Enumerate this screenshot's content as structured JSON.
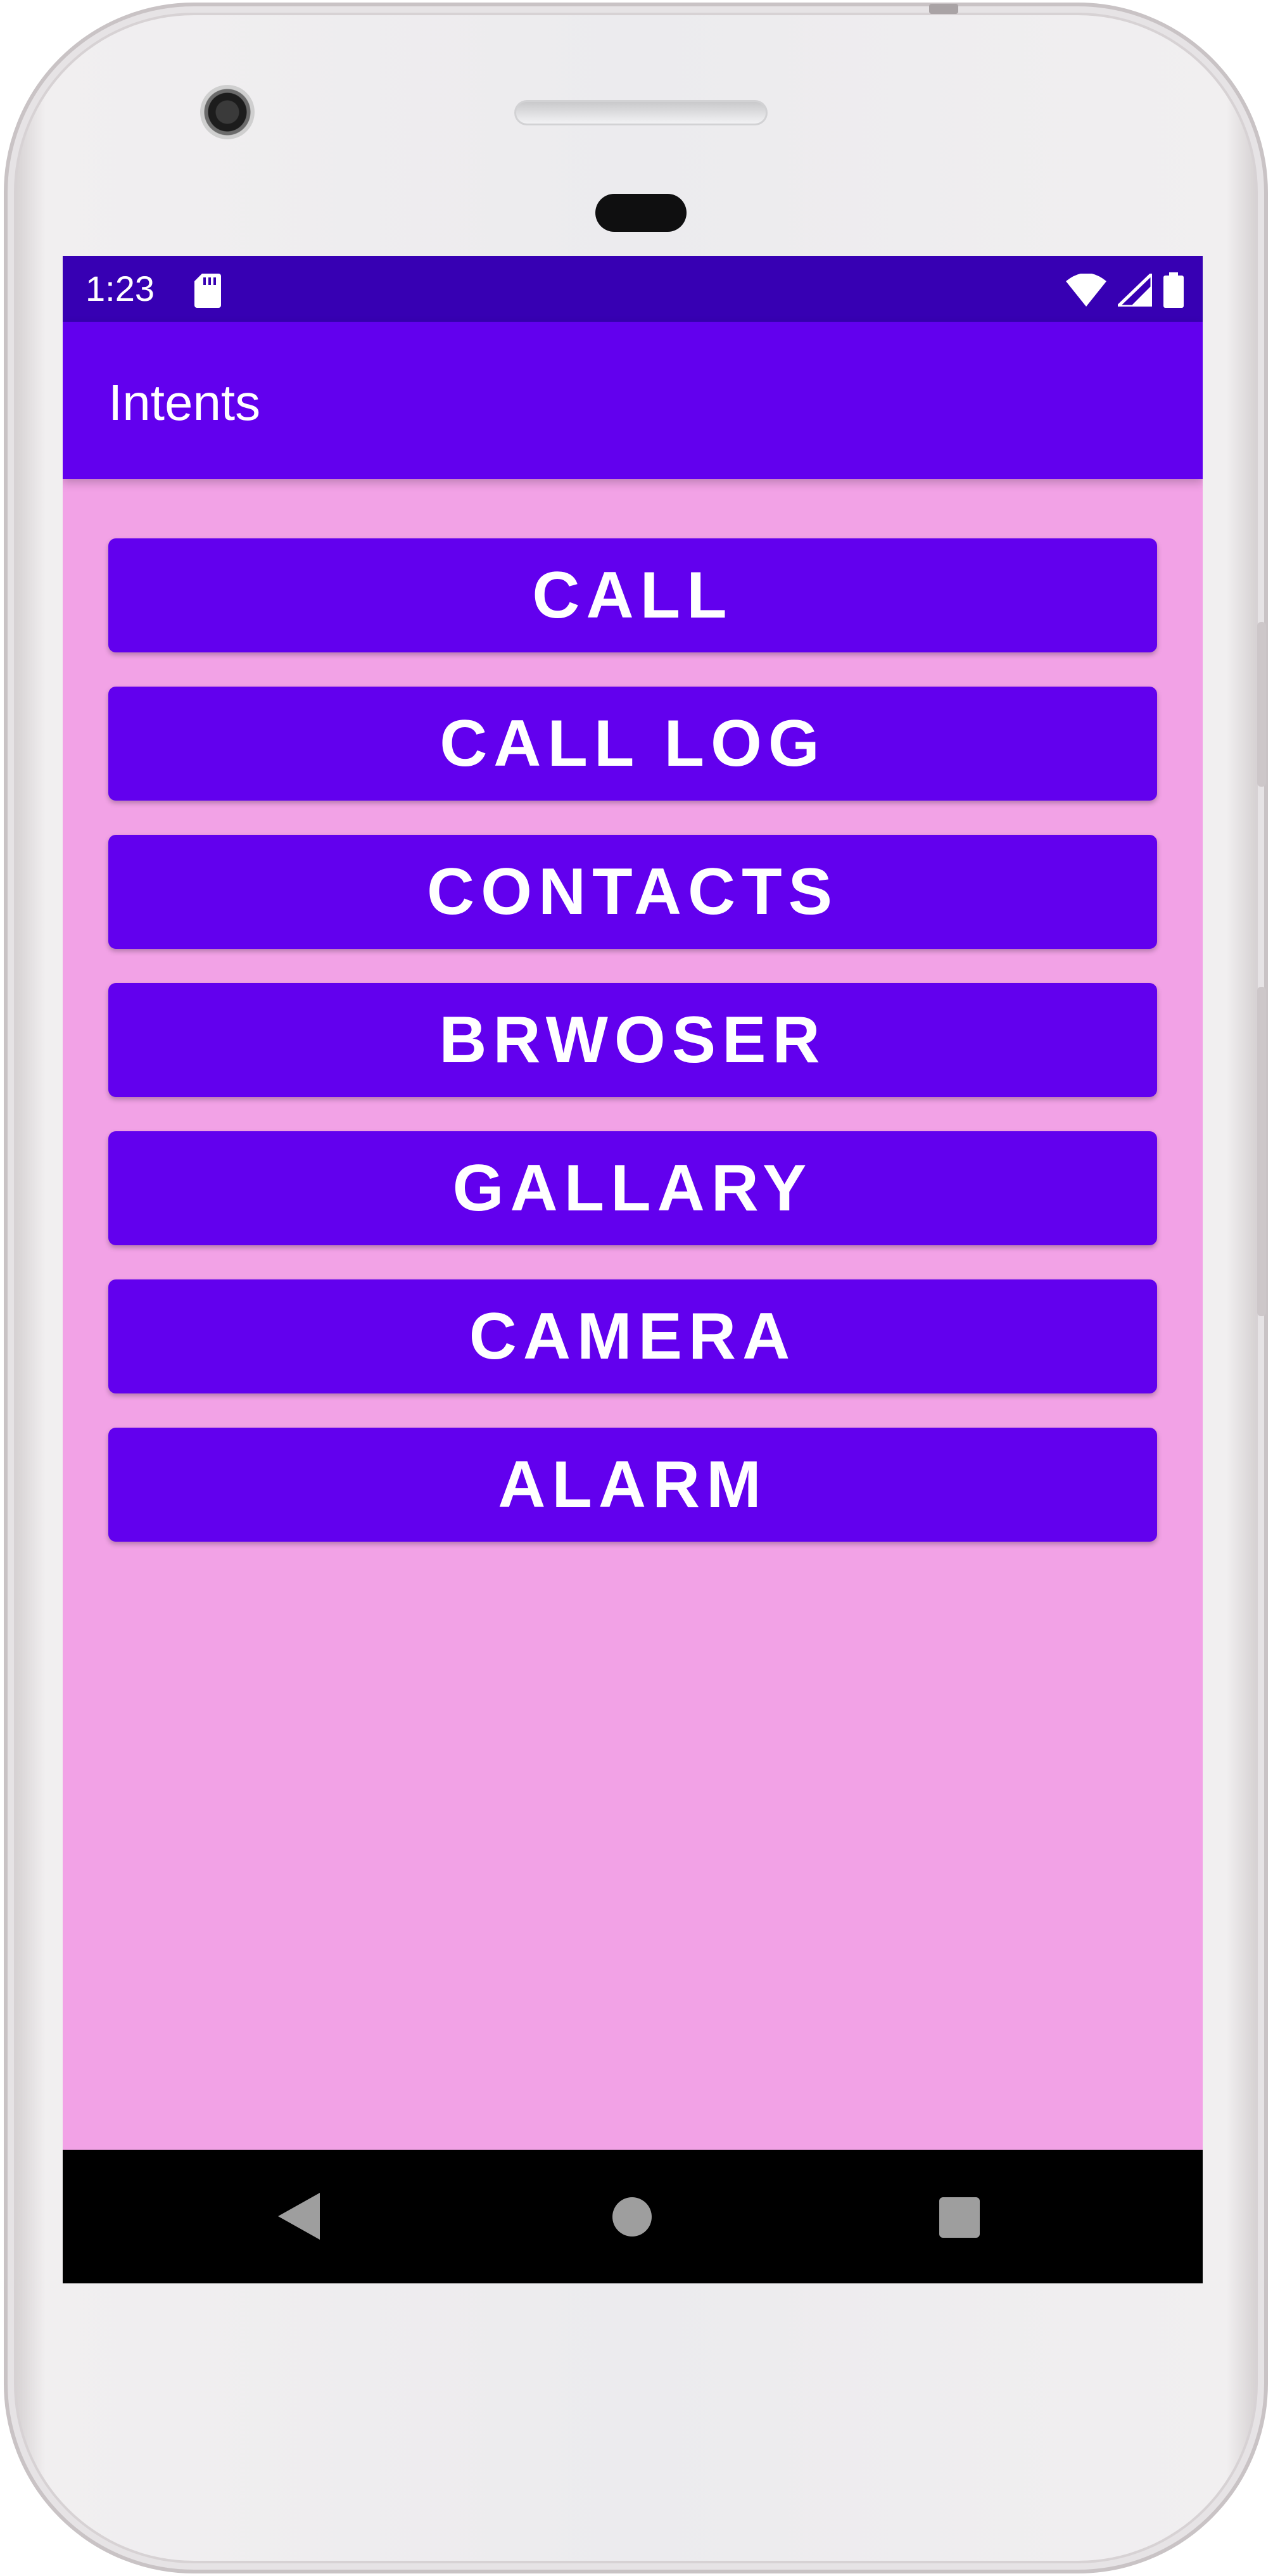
{
  "status_bar": {
    "time": "1:23",
    "icons": [
      "sd-card-icon",
      "wifi-icon",
      "cell-signal-icon",
      "battery-icon"
    ]
  },
  "app_bar": {
    "title": "Intents"
  },
  "buttons": [
    {
      "label": "CALL"
    },
    {
      "label": "CALL LOG"
    },
    {
      "label": "CONTACTS"
    },
    {
      "label": "BRWOSER"
    },
    {
      "label": "GALLARY"
    },
    {
      "label": "CAMERA"
    },
    {
      "label": "ALARM"
    }
  ],
  "nav_bar": {
    "icons": [
      "back-icon",
      "home-icon",
      "recents-icon"
    ]
  },
  "colors": {
    "status_bar": "#3700b3",
    "app_bar": "#6200ee",
    "button": "#6200ee",
    "background": "#f2a2e6",
    "nav_bar": "#000000"
  }
}
